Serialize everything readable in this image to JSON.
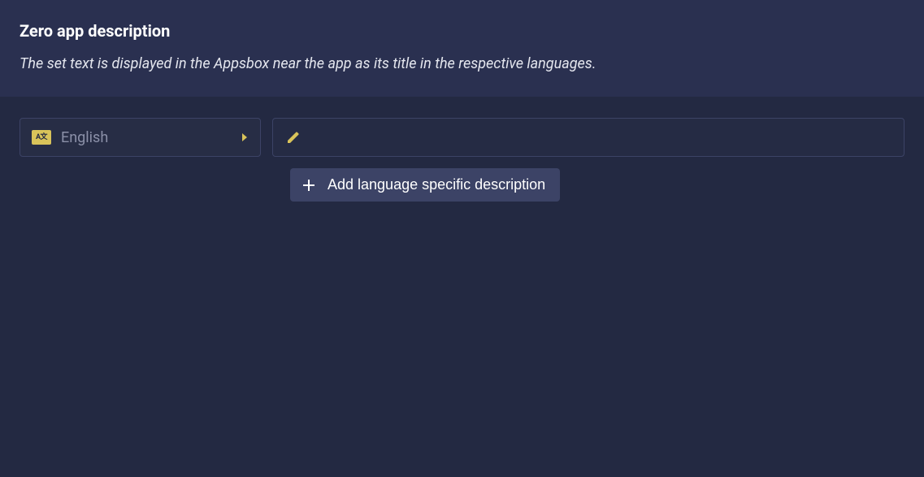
{
  "header": {
    "title": "Zero app description",
    "subtitle": "The set text is displayed in the Appsbox near the app as its title in the respective languages."
  },
  "language_selector": {
    "selected": "English"
  },
  "description_input": {
    "value": "",
    "placeholder": ""
  },
  "add_button": {
    "label": "Add language specific description"
  },
  "colors": {
    "accent": "#d9c35a"
  }
}
